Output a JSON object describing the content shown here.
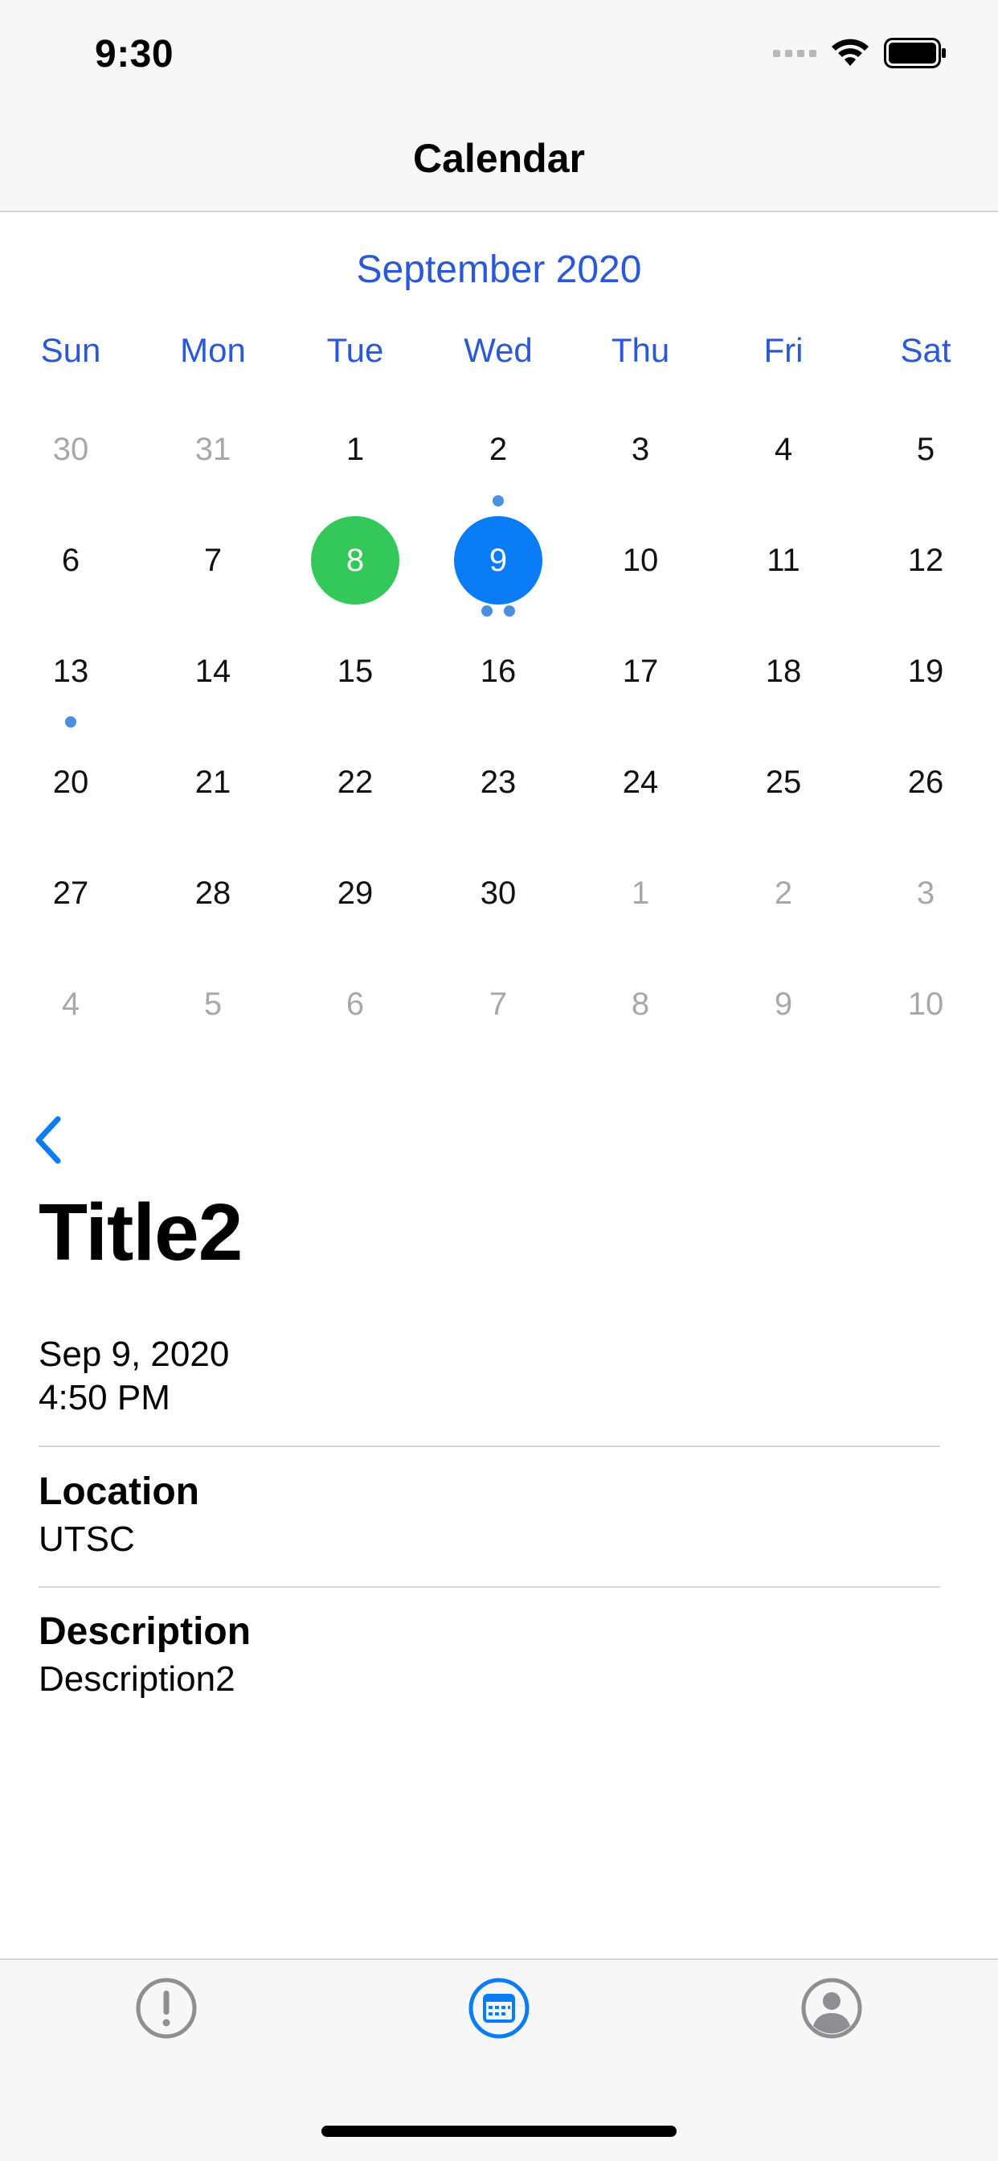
{
  "status_bar": {
    "time": "9:30"
  },
  "nav": {
    "title": "Calendar"
  },
  "calendar": {
    "month_label": "September 2020",
    "weekdays": [
      "Sun",
      "Mon",
      "Tue",
      "Wed",
      "Thu",
      "Fri",
      "Sat"
    ],
    "weeks": [
      [
        {
          "d": "30",
          "muted": true
        },
        {
          "d": "31",
          "muted": true
        },
        {
          "d": "1"
        },
        {
          "d": "2"
        },
        {
          "d": "3"
        },
        {
          "d": "4"
        },
        {
          "d": "5"
        }
      ],
      [
        {
          "d": "6"
        },
        {
          "d": "7"
        },
        {
          "d": "8",
          "state": "today"
        },
        {
          "d": "9",
          "state": "selected",
          "dots_above": 1,
          "dots_below": 2
        },
        {
          "d": "10"
        },
        {
          "d": "11"
        },
        {
          "d": "12"
        }
      ],
      [
        {
          "d": "13",
          "dots_below": 1
        },
        {
          "d": "14"
        },
        {
          "d": "15"
        },
        {
          "d": "16"
        },
        {
          "d": "17"
        },
        {
          "d": "18"
        },
        {
          "d": "19"
        }
      ],
      [
        {
          "d": "20"
        },
        {
          "d": "21"
        },
        {
          "d": "22"
        },
        {
          "d": "23"
        },
        {
          "d": "24"
        },
        {
          "d": "25"
        },
        {
          "d": "26"
        }
      ],
      [
        {
          "d": "27"
        },
        {
          "d": "28"
        },
        {
          "d": "29"
        },
        {
          "d": "30"
        },
        {
          "d": "1",
          "muted": true
        },
        {
          "d": "2",
          "muted": true
        },
        {
          "d": "3",
          "muted": true
        }
      ],
      [
        {
          "d": "4",
          "muted": true
        },
        {
          "d": "5",
          "muted": true
        },
        {
          "d": "6",
          "muted": true
        },
        {
          "d": "7",
          "muted": true
        },
        {
          "d": "8",
          "muted": true
        },
        {
          "d": "9",
          "muted": true
        },
        {
          "d": "10",
          "muted": true
        }
      ]
    ]
  },
  "event": {
    "title": "Title2",
    "date": "Sep 9, 2020",
    "time": "4:50 PM",
    "location_label": "Location",
    "location_value": "UTSC",
    "description_label": "Description",
    "description_value": "Description2"
  },
  "tabbar": {
    "tabs": [
      {
        "icon": "exclamation-circle-icon",
        "active": false
      },
      {
        "icon": "calendar-icon",
        "active": true
      },
      {
        "icon": "person-circle-icon",
        "active": false
      }
    ]
  },
  "colors": {
    "accent": "#0a7cf5",
    "calendar_header": "#2a58d6",
    "today": "#34c759",
    "event_dot": "#4a8fe0",
    "muted_text": "#a8a8a8",
    "inactive_tab": "#8e8e93"
  }
}
